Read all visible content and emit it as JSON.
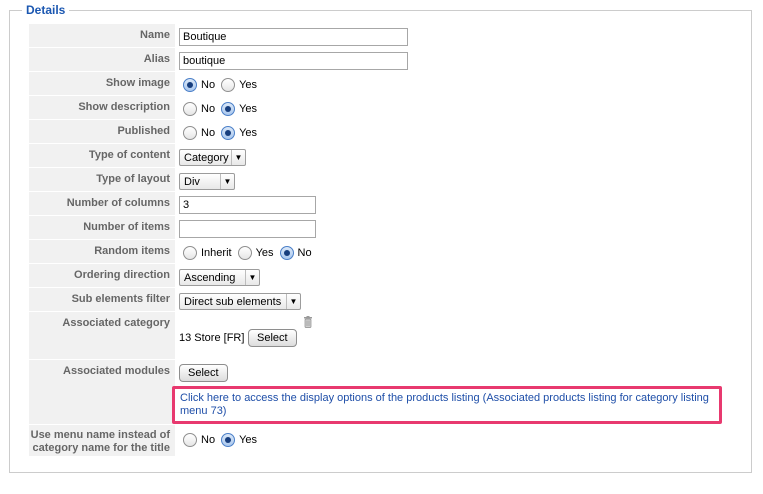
{
  "fieldset": {
    "legend": "Details"
  },
  "rows": {
    "name": {
      "label": "Name",
      "value": "Boutique"
    },
    "alias": {
      "label": "Alias",
      "value": "boutique"
    },
    "show_image": {
      "label": "Show image",
      "options": [
        "No",
        "Yes"
      ],
      "selected": "No"
    },
    "show_description": {
      "label": "Show description",
      "options": [
        "No",
        "Yes"
      ],
      "selected": "Yes"
    },
    "published": {
      "label": "Published",
      "options": [
        "No",
        "Yes"
      ],
      "selected": "Yes"
    },
    "type_of_content": {
      "label": "Type of content",
      "value": "Category"
    },
    "type_of_layout": {
      "label": "Type of layout",
      "value": "Div"
    },
    "number_of_columns": {
      "label": "Number of columns",
      "value": "3"
    },
    "number_of_items": {
      "label": "Number of items",
      "value": ""
    },
    "random_items": {
      "label": "Random items",
      "options": [
        "Inherit",
        "Yes",
        "No"
      ],
      "selected": "No"
    },
    "ordering_direction": {
      "label": "Ordering direction",
      "value": "Ascending"
    },
    "sub_elements_filter": {
      "label": "Sub elements filter",
      "value": "Direct sub elements"
    },
    "associated_category": {
      "label": "Associated category",
      "value": "13 Store [FR]",
      "button": "Select",
      "icon": "trash-icon"
    },
    "associated_modules": {
      "label": "Associated modules",
      "button": "Select"
    },
    "display_options_link": "Click here to access the display options of the products listing (Associated products listing for category listing menu 73)",
    "use_menu_name": {
      "label": "Use menu name instead of category name for the title",
      "options": [
        "No",
        "Yes"
      ],
      "selected": "Yes"
    }
  },
  "colors": {
    "legend": "#1b57b1",
    "label_text": "#666666",
    "label_bg": "#f1f1f1",
    "highlight": "#e8396f",
    "link": "#1e4ea8"
  }
}
